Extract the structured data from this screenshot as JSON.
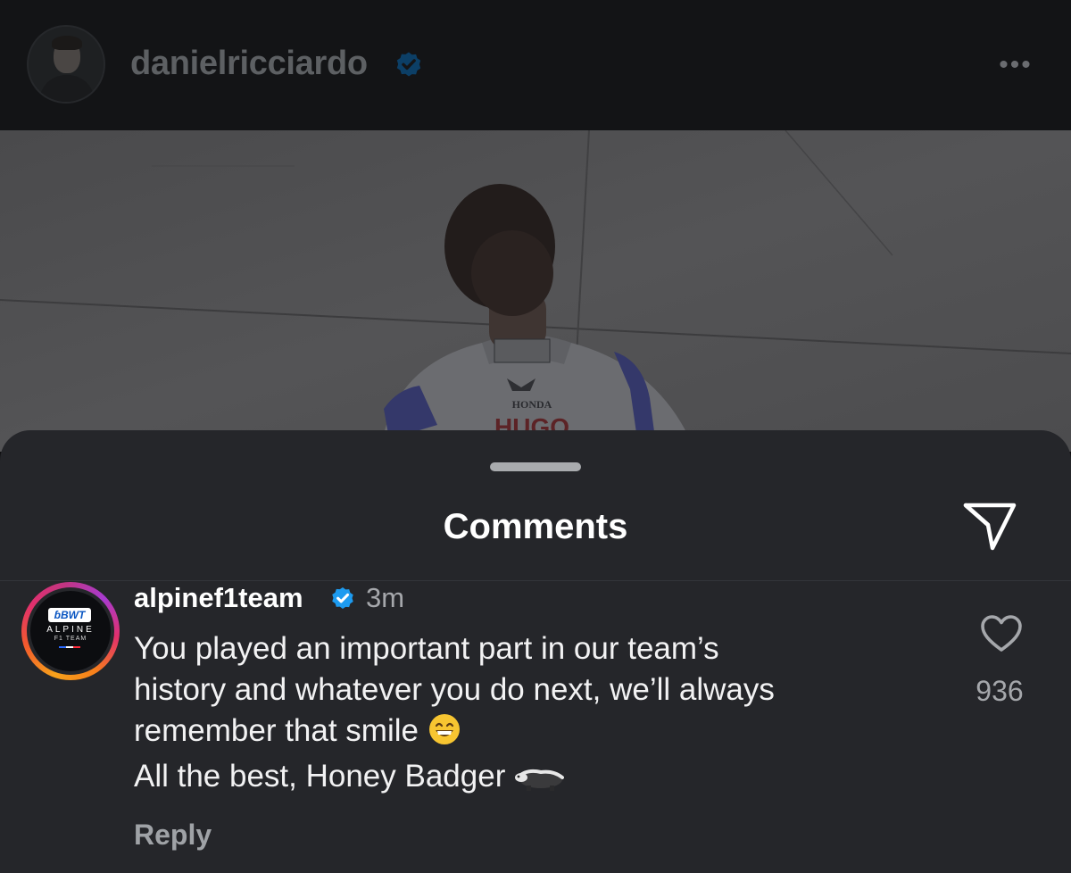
{
  "post_header": {
    "username": "danielricciardo",
    "avatar_icon": "profile-avatar",
    "verified_icon": "verified-badge-icon",
    "more_icon": "more-options-icon",
    "more_glyph": "•••"
  },
  "post_photo": {
    "jersey_texts": [
      "HONDA",
      "HUGO"
    ]
  },
  "comments_sheet": {
    "title": "Comments",
    "share_icon": "send-icon",
    "comments": [
      {
        "username": "alpinef1team",
        "verified": true,
        "time": "3m",
        "text_lines": [
          "You played an important part in our team’s",
          "history and whatever you do next, we’ll always",
          "remember that smile"
        ],
        "second_paragraph": "All the best, Honey Badger",
        "emojis": [
          "grinning-face-emoji",
          "badger-emoji"
        ],
        "avatar_logo": {
          "brand": "BWT",
          "name": "ALPINE",
          "sub": "F1 TEAM"
        },
        "like_count": "936",
        "reply_label": "Reply"
      }
    ]
  },
  "colors": {
    "sheet_background": "#25262a",
    "verified_blue": "#1d9bf0",
    "text_primary": "#ffffff",
    "text_secondary": "#a5a7ab"
  }
}
